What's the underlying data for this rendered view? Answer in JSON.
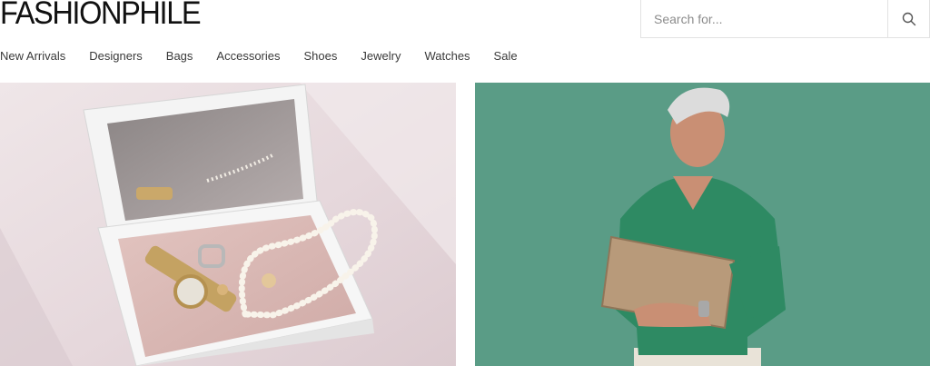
{
  "brand": {
    "logo_text": "FASHIONPHILE"
  },
  "search": {
    "placeholder": "Search for...",
    "icon": "search-icon"
  },
  "nav": {
    "items": [
      {
        "label": "New Arrivals"
      },
      {
        "label": "Designers"
      },
      {
        "label": "Bags"
      },
      {
        "label": "Accessories"
      },
      {
        "label": "Shoes"
      },
      {
        "label": "Jewelry"
      },
      {
        "label": "Watches"
      },
      {
        "label": "Sale"
      }
    ]
  },
  "colors": {
    "left_hero_bg": "#e9dde0",
    "right_hero_bg": "#5a9c86",
    "sweater": "#2e8a63",
    "box_interior": "#d9b8b5"
  }
}
